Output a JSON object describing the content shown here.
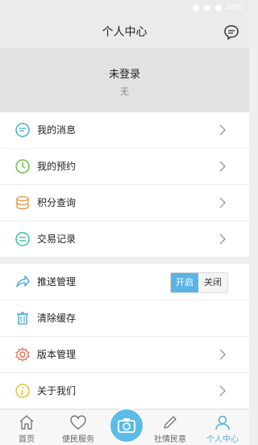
{
  "header": {
    "title": "个人中心",
    "message_icon": "chat-bubble-icon"
  },
  "profile": {
    "name": "未登录",
    "subtitle": "无"
  },
  "menu_group1": [
    {
      "label": "我的消息",
      "icon": "message-icon",
      "color": "#4aa8d8"
    },
    {
      "label": "我的预约",
      "icon": "clock-icon",
      "color": "#6cc04a"
    },
    {
      "label": "积分查询",
      "icon": "coins-icon",
      "color": "#e89a4a"
    },
    {
      "label": "交易记录",
      "icon": "record-icon",
      "color": "#34c2a0"
    }
  ],
  "menu_group2": [
    {
      "label": "推送管理",
      "icon": "share-icon",
      "color": "#4aa8d8"
    },
    {
      "label": "清除缓存",
      "icon": "trash-icon",
      "color": "#4aa8d8"
    },
    {
      "label": "版本管理",
      "icon": "gear-icon",
      "color": "#e07050"
    },
    {
      "label": "关于我们",
      "icon": "info-icon",
      "color": "#e6c22a"
    }
  ],
  "push_toggle": {
    "on_label": "开启",
    "off_label": "关闭",
    "selected": "开启"
  },
  "tabbar": [
    {
      "label": "首页",
      "icon": "home-icon"
    },
    {
      "label": "便民服务",
      "icon": "heart-icon"
    },
    {
      "label": "",
      "icon": "camera-icon"
    },
    {
      "label": "社情民意",
      "icon": "pen-icon"
    },
    {
      "label": "个人中心",
      "icon": "person-icon",
      "active": true
    }
  ],
  "colors": {
    "accent": "#5ab4e5",
    "header_bg": "#ebebeb",
    "profile_bg": "#e2e2e2"
  }
}
